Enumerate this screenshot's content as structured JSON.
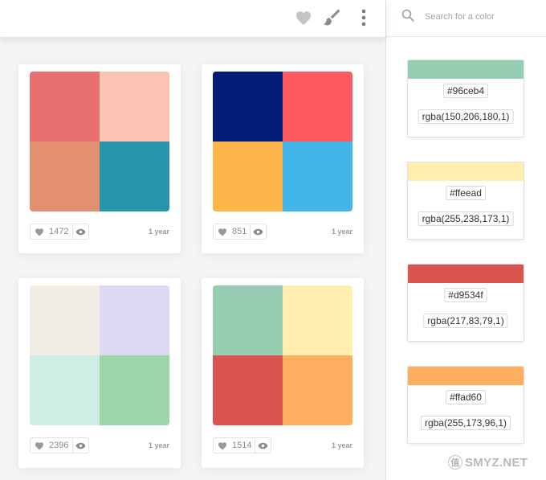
{
  "colors": {
    "icon_gray": "#b3b3b3",
    "icon_dark": "#7a7a7a",
    "card_bg": "#ffffff",
    "sidebar_border": "#e0e0e0"
  },
  "topbar": {
    "icons": [
      "heart-icon",
      "paint-brush-icon",
      "more-vertical-icon"
    ]
  },
  "search": {
    "placeholder": "Search for a color"
  },
  "palettes": [
    {
      "colors": [
        "#e8706e",
        "#fcc2b2",
        "#e2906f",
        "#2595ae"
      ],
      "likes": "1472",
      "age": "1 year"
    },
    {
      "colors": [
        "#021b79",
        "#fe5a5f",
        "#fdb448",
        "#41b5e5"
      ],
      "likes": "851",
      "age": "1 year"
    },
    {
      "colors": [
        "#f2ede4",
        "#dcdaf2",
        "#cdefe3",
        "#9ed5a8"
      ],
      "likes": "2396",
      "age": "1 year"
    },
    {
      "colors": [
        "#96ceb4",
        "#ffeead",
        "#d9534f",
        "#ffad60"
      ],
      "likes": "1514",
      "age": "1 year"
    }
  ],
  "sidebar_colors": [
    {
      "swatch": "#96ceb4",
      "hex": "#96ceb4",
      "rgba": "rgba(150,206,180,1)"
    },
    {
      "swatch": "#ffeead",
      "hex": "#ffeead",
      "rgba": "rgba(255,238,173,1)"
    },
    {
      "swatch": "#d9534f",
      "hex": "#d9534f",
      "rgba": "rgba(217,83,79,1)"
    },
    {
      "swatch": "#ffad60",
      "hex": "#ffad60",
      "rgba": "rgba(255,173,96,1)"
    }
  ],
  "watermark": {
    "text": "SMYZ.NET",
    "glyph": "值"
  }
}
